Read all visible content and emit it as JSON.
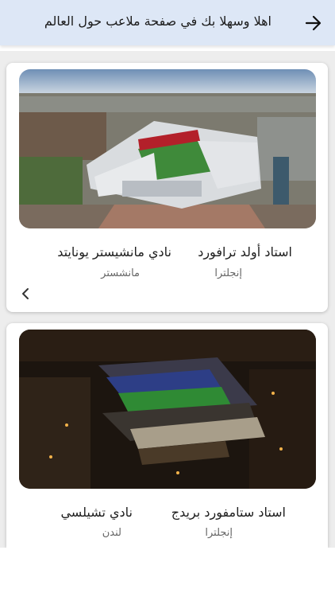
{
  "header": {
    "title": "اهلا وسهلا بك في صفحة ملاعب حول العالم",
    "back_icon": "arrow-right-icon"
  },
  "cards": [
    {
      "stadium": "استاد أولد ترافورد",
      "country": "إنجلترا",
      "club": "نادي مانشيستر يونايتد",
      "city": "مانشستر",
      "image_icon": "stadium-photo-daytime"
    },
    {
      "stadium": "استاد ستامفورد بريدج",
      "country": "إنجلترا",
      "club": "نادي تشيلسي",
      "city": "لندن",
      "image_icon": "stadium-photo-night"
    }
  ],
  "chevron_icon": "chevron-left-icon",
  "colors": {
    "header_bg": "#dde7f6",
    "list_bg": "#ededed",
    "card_bg": "#ffffff"
  }
}
